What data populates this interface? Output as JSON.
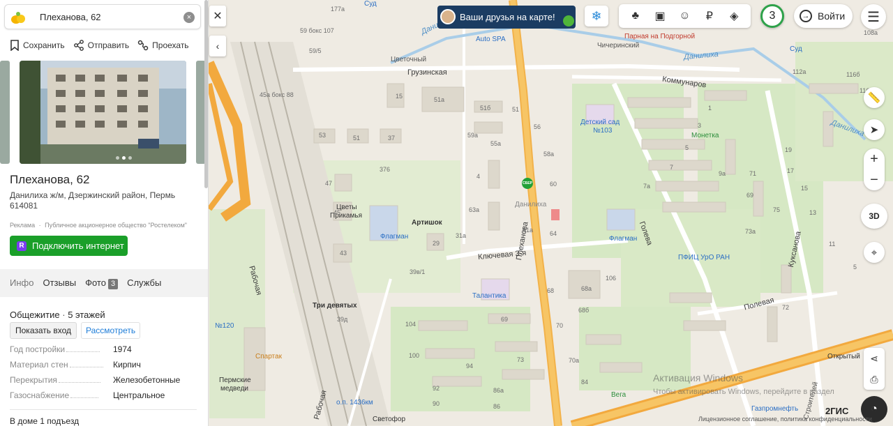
{
  "search": {
    "value": "Плеханова, 62"
  },
  "actions": {
    "save": "Сохранить",
    "send": "Отправить",
    "route": "Проехать"
  },
  "place": {
    "title": "Плеханова, 62",
    "subtitle": "Данилиха ж/м, Дзержинский район, Пермь",
    "postcode": "614081"
  },
  "ad": {
    "label": "Реклама",
    "advertiser": "Публичное акционерное общество \"Ростелеком\"",
    "button": "Подключить интернет"
  },
  "tabs": {
    "info": "Инфо",
    "reviews": "Отзывы",
    "photos": "Фото",
    "photos_count": "3",
    "services": "Службы"
  },
  "building": {
    "type": "Общежитие",
    "floors": "5 этажей",
    "show_entrance": "Показать вход",
    "view": "Рассмотреть",
    "props": [
      {
        "k": "Год постройки",
        "v": "1974"
      },
      {
        "k": "Материал стен",
        "v": "Кирпич"
      },
      {
        "k": "Перекрытия",
        "v": "Железобетонные"
      },
      {
        "k": "Газоснабжение",
        "v": "Центральное"
      }
    ],
    "entrances": "В доме 1 подъезд"
  },
  "map_ui": {
    "promo": "Ваши друзья на карте!",
    "count": "3",
    "login": "Войти",
    "threed": "3D",
    "brand": "2ГИС",
    "license": "Лицензионное соглашение, политика конфиденциальности",
    "activation_title": "Активация Windows",
    "activation_sub": "Чтобы активировать Windows, перейдите в раздел"
  },
  "streets": {
    "gruzinskaya": "Грузинская",
    "klyuchevaya": "Ключевая 3-я",
    "plekhanova": "Плеханова",
    "golева": "Голева",
    "kommunarov": "Коммунаров",
    "kuksanova": "Куксанова",
    "polevaya": "Полевая",
    "rabochaya1": "Рабочая",
    "rabochaya2": "Рабочая",
    "danilikha_river1": "Данилиха",
    "danilikha_river2": "Данилиха",
    "danilikha_river3": "Данилиха",
    "chicherinsky": "Чичеринский",
    "tsvetochny": "Цветочный",
    "stroitelnaya": "Строителей"
  },
  "pois": {
    "sud1": "Суд",
    "sud2": "Суд",
    "autospa": "Auto SPA",
    "parnaya": "Парная на Подгорной",
    "detsad": "Детский сад",
    "detsad_no": "№103",
    "monetka": "Монетка",
    "flagman1": "Флагман",
    "flagman2": "Флагман",
    "pfic": "ПФИЦ УрО РАН",
    "tsvety": "Цветы",
    "prikamya": "Прикамья",
    "artishok": "Артишок",
    "talantika": "Талантика",
    "tri_devyatykh": "Три девятых",
    "spartak": "Спартак",
    "permskie": "Пермские",
    "medvedi": "медведи",
    "op": "о.п. 1436км",
    "svetofor": "Светофор",
    "vega": "Вега",
    "gazprom": "Газпромнефть",
    "otkryty": "Открытый",
    "no120": "№120",
    "danilikha_area": "Данилиха"
  },
  "house_numbers": [
    "177а",
    "59 бокс 107",
    "59/5",
    "45а бокс 88",
    "15",
    "51а",
    "51б",
    "51",
    "56",
    "53",
    "51",
    "37",
    "59а",
    "55а",
    "58а",
    "47",
    "376",
    "4",
    "60",
    "45",
    "63а",
    "61а",
    "43",
    "29",
    "31а",
    "39в/1",
    "68а",
    "106",
    "39д",
    "104",
    "69",
    "73",
    "100",
    "94",
    "92",
    "90",
    "86а",
    "86",
    "84",
    "72",
    "73а",
    "75",
    "71",
    "69",
    "9а",
    "7а",
    "7",
    "5",
    "3",
    "1",
    "64",
    "68",
    "68б",
    "70",
    "70а",
    "5",
    "11",
    "13",
    "15",
    "17",
    "19",
    "108а",
    "112а",
    "116б",
    "116в",
    "1"
  ]
}
